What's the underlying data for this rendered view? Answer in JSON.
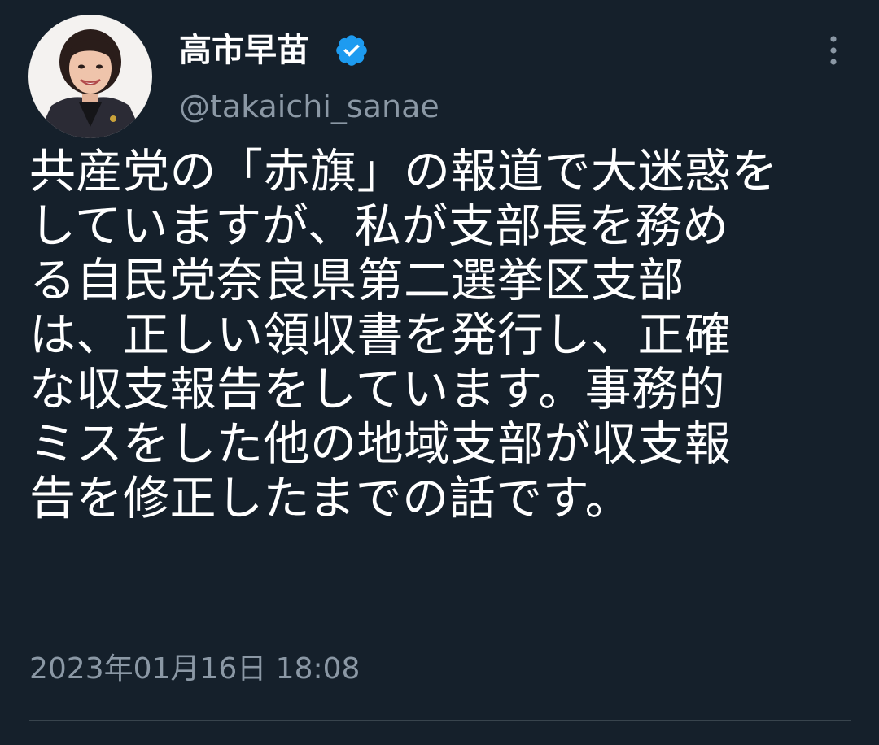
{
  "tweet": {
    "author": {
      "display_name": "高市早苗",
      "handle": "@takaichi_sanae",
      "verified": true,
      "avatar_icon": "profile-photo"
    },
    "text_lines": [
      "共産党の「赤旗」の報道で大迷惑を",
      "していますが、私が支部長を務め",
      "る自民党奈良県第二選挙区支部",
      "は、正しい領収書を発行し、正確",
      "な収支報告をしています。事務的",
      "ミスをした他の地域支部が収支報",
      "告を修正したまでの話です。"
    ],
    "timestamp": "2023年01月16日 18:08"
  },
  "colors": {
    "background": "#15202b",
    "text_primary": "#ffffff",
    "text_secondary": "#8b98a5",
    "verified_badge": "#1d9bf0",
    "divider": "#38444d"
  },
  "icons": {
    "verified": "verified-badge-icon",
    "more": "more-options-icon"
  }
}
